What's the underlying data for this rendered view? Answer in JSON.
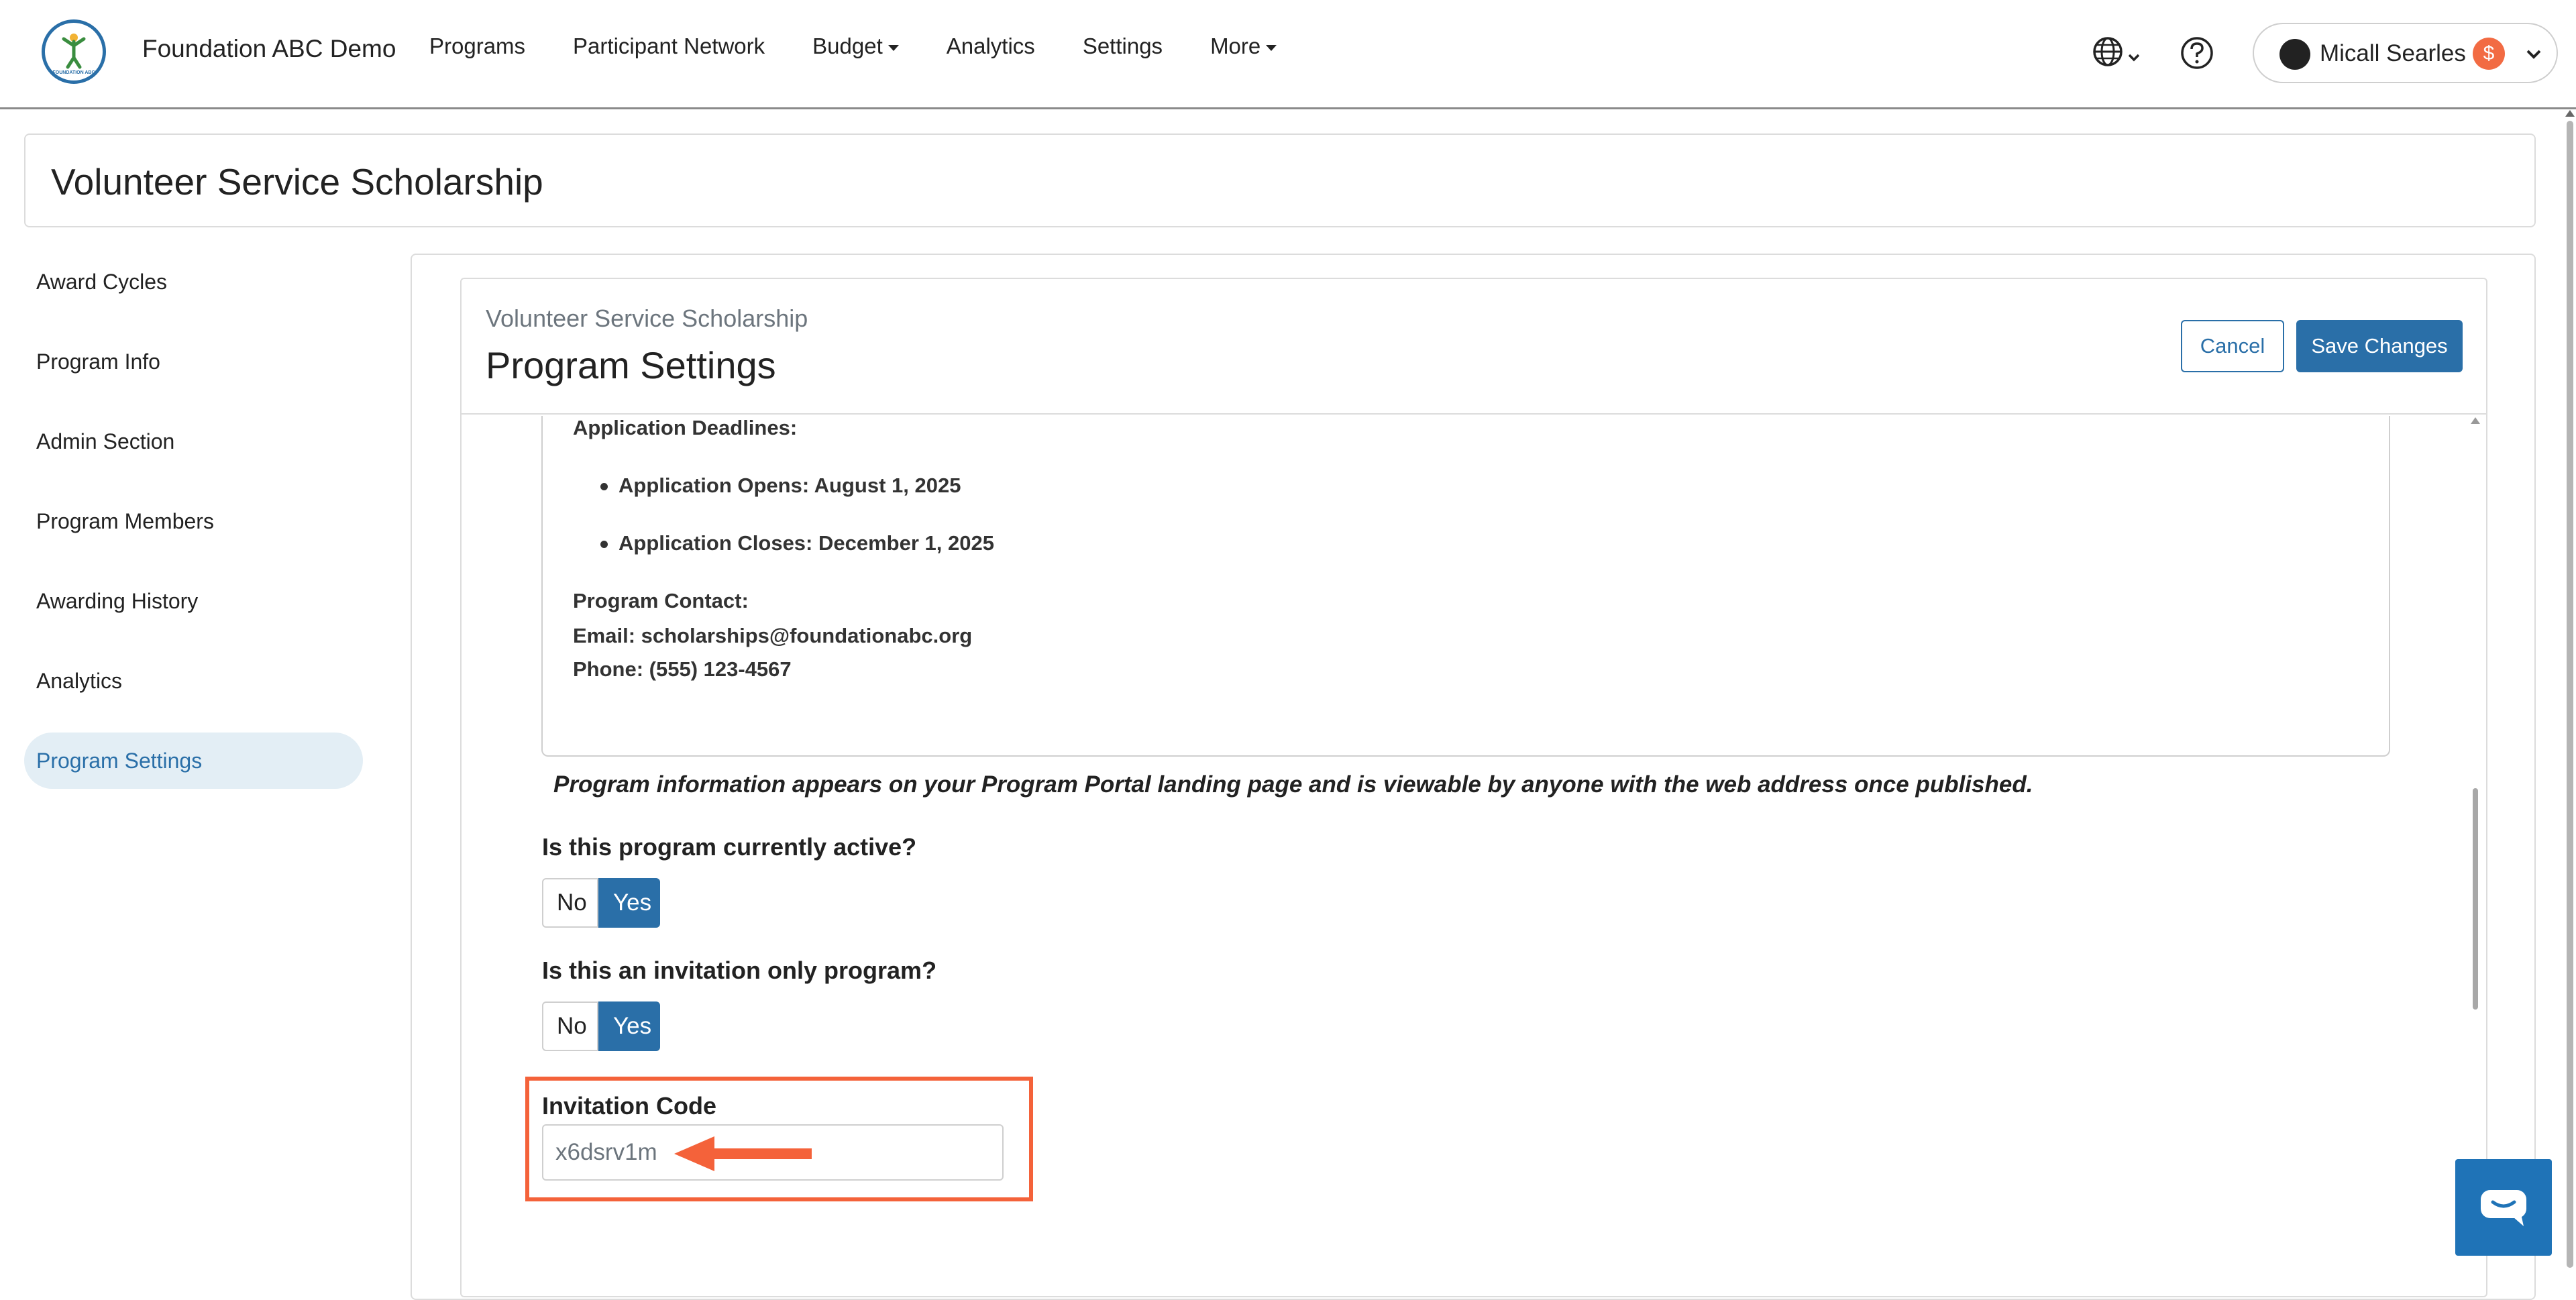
{
  "header": {
    "org_name": "Foundation ABC Demo",
    "logo_text": "FOUNDATION ABC",
    "nav": [
      {
        "label": "Programs",
        "has_caret": false
      },
      {
        "label": "Participant Network",
        "has_caret": false
      },
      {
        "label": "Budget",
        "has_caret": true
      },
      {
        "label": "Analytics",
        "has_caret": false
      },
      {
        "label": "Settings",
        "has_caret": false
      },
      {
        "label": "More",
        "has_caret": true
      }
    ],
    "user": {
      "name": "Micall Searles",
      "badge": "$"
    }
  },
  "page_title": "Volunteer Service Scholarship",
  "sidebar": {
    "items": [
      {
        "label": "Award Cycles"
      },
      {
        "label": "Program Info"
      },
      {
        "label": "Admin Section"
      },
      {
        "label": "Program Members"
      },
      {
        "label": "Awarding History"
      },
      {
        "label": "Analytics"
      },
      {
        "label": "Program Settings"
      }
    ],
    "active": "Program Settings"
  },
  "panel": {
    "subtitle": "Volunteer Service Scholarship",
    "title": "Program Settings",
    "cancel_label": "Cancel",
    "save_label": "Save Changes"
  },
  "program_info": {
    "deadlines_heading": "Application Deadlines:",
    "bullets": [
      "Application Opens: August 1, 2025",
      "Application Closes: December 1, 2025"
    ],
    "contact_heading": "Program Contact:",
    "email_line": "Email: scholarships@foundationabc.org",
    "phone_line": "Phone: (555) 123-4567",
    "note": "Program information appears on your Program Portal landing page and is viewable by anyone with the web address once published."
  },
  "questions": {
    "active": {
      "label": "Is this program currently active?",
      "no": "No",
      "yes": "Yes",
      "selected": "Yes"
    },
    "invitation_only": {
      "label": "Is this an invitation only program?",
      "no": "No",
      "yes": "Yes",
      "selected": "Yes"
    }
  },
  "invitation": {
    "label": "Invitation Code",
    "value": "x6dsrv1m"
  },
  "colors": {
    "primary": "#2a6fa8",
    "highlight": "#f4623a",
    "chat": "#1f73b7"
  }
}
